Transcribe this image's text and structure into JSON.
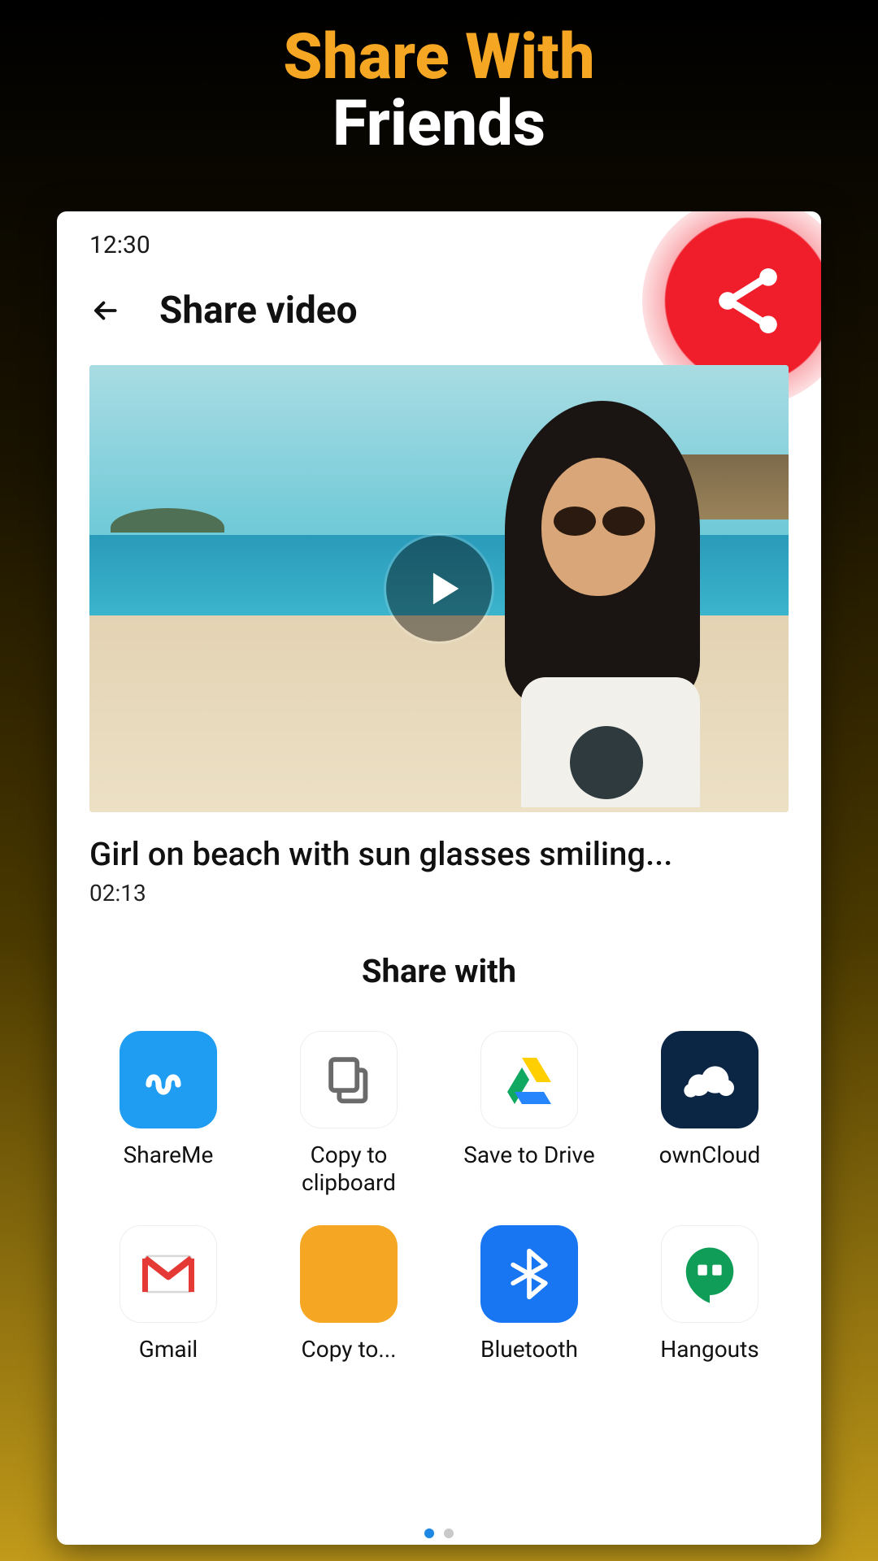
{
  "promo": {
    "line1": "Share With",
    "line2": "Friends"
  },
  "status": {
    "time": "12:30"
  },
  "header": {
    "title": "Share video"
  },
  "video": {
    "caption": "Girl on beach with sun glasses smiling...",
    "duration": "02:13"
  },
  "share": {
    "heading": "Share with",
    "items": [
      {
        "label": "ShareMe",
        "icon": "shareme"
      },
      {
        "label": "Copy to clipboard",
        "icon": "copy"
      },
      {
        "label": "Save to Drive",
        "icon": "drive"
      },
      {
        "label": "ownCloud",
        "icon": "owncloud"
      },
      {
        "label": "Gmail",
        "icon": "gmail"
      },
      {
        "label": "Copy to...",
        "icon": "copyto"
      },
      {
        "label": "Bluetooth",
        "icon": "bt"
      },
      {
        "label": "Hangouts",
        "icon": "hangouts"
      }
    ]
  },
  "pager": {
    "count": 2,
    "active": 0
  }
}
